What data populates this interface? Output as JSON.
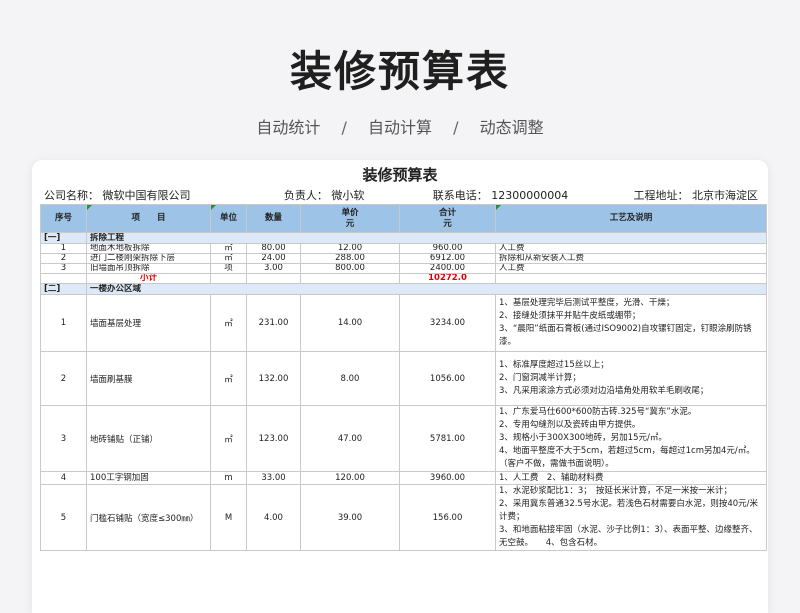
{
  "hero": {
    "title": "装修预算表",
    "tags": [
      "自动统计",
      "自动计算",
      "动态调整"
    ],
    "separator": "/"
  },
  "sheet": {
    "title": "装修预算表",
    "company": "公司名称： 微软中国有限公司",
    "person": "负责人： 微小软",
    "phone": "联系电话： 12300000004",
    "address": "工程地址： 北京市海淀区"
  },
  "columns": {
    "idx": "序号",
    "item": "项　　目",
    "unit": "单位",
    "qty": "数量",
    "price": "单价\n元",
    "total": "合计\n元",
    "desc": "工艺及说明"
  },
  "groups": [
    {
      "code": "[一]",
      "name": "拆除工程",
      "rows": [
        {
          "idx": "1",
          "item": "地面木地板拆除",
          "unit": "㎡",
          "qty": "80.00",
          "price": "12.00",
          "total": "960.00",
          "desc": "人工费"
        },
        {
          "idx": "2",
          "item": "进门二楼刚架拆除下层",
          "unit": "㎡",
          "qty": "24.00",
          "price": "288.00",
          "total": "6912.00",
          "desc": "拆除和从新安装人工费"
        },
        {
          "idx": "3",
          "item": "旧墙面吊顶拆除",
          "unit": "项",
          "qty": "3.00",
          "price": "800.00",
          "total": "2400.00",
          "desc": "人工费"
        }
      ],
      "subtotal_label": "小计",
      "subtotal_value": "10272.0"
    },
    {
      "code": "[二]",
      "name": "一楼办公区域",
      "rows": [
        {
          "idx": "1",
          "item": "墙面基层处理",
          "unit": "㎡",
          "qty": "231.00",
          "price": "14.00",
          "total": "3234.00",
          "desc": [
            "1、基层处理完毕后测试平整度，光滑、干燥；",
            "2、接缝处须抹平并贴牛皮纸或绷带；",
            "3、“晨阳”纸面石膏板(通过ISO9002)自攻镙钉固定，钉眼涂刷防锈漆。"
          ]
        },
        {
          "idx": "2",
          "item": "墙面刷基膜",
          "unit": "㎡",
          "qty": "132.00",
          "price": "8.00",
          "total": "1056.00",
          "desc": [
            "1、标准厚度超过15丝以上；",
            "2、门窗洞减半计算；",
            "3、凡采用滚涂方式必须对边沿墙角处用软羊毛刷收尾；"
          ]
        },
        {
          "idx": "3",
          "item": "地砖铺贴（正铺）",
          "unit": "㎡",
          "qty": "123.00",
          "price": "47.00",
          "total": "5781.00",
          "desc": [
            "1、广东爱马仕600*600防古砖.325号“冀东”水泥。",
            "2、专用勾缝剂以及瓷砖由甲方提供。",
            "3、规格小于300X300地砖，另加15元/㎡。",
            "4、地面平整度不大于5cm，若超过5cm，每超过1cm另加4元/㎡。（客户不做，需做书面说明）。"
          ]
        },
        {
          "idx": "4",
          "item": "100工字钢加固",
          "unit": "m",
          "qty": "33.00",
          "price": "120.00",
          "total": "3960.00",
          "desc": [
            "1、人工费　2、辅助材料费"
          ]
        },
        {
          "idx": "5",
          "item": "门槛石铺贴（宽度≤300㎜）",
          "unit": "M",
          "qty": "4.00",
          "price": "39.00",
          "total": "156.00",
          "desc": [
            "1、水泥砂浆配比1：3；　按延长米计算，不足一米按一米计；",
            "2、采用冀东普通32.5号水泥。若浅色石材需要白水泥，则按40元/米计费；",
            "3、和地面粘接牢固（水泥、沙子比例1：3）、表面平整、边缘整齐、无空鼓。　　4、包含石材。"
          ]
        }
      ]
    }
  ]
}
